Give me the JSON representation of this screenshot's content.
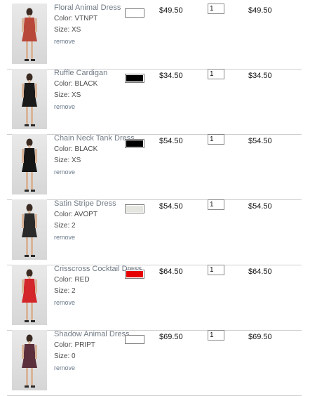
{
  "remove_label": "remove",
  "color_prefix": "Color: ",
  "size_prefix": "Size: ",
  "items": [
    {
      "name": "Floral Animal Dress",
      "color": "VTNPT",
      "size": "XS",
      "price": "$49.50",
      "qty": "1",
      "total": "$49.50",
      "swatch": "#ffffff",
      "dress": "#b8483a"
    },
    {
      "name": "Ruffle Cardigan",
      "color": "BLACK",
      "size": "XS",
      "price": "$34.50",
      "qty": "1",
      "total": "$34.50",
      "swatch": "#000000",
      "dress": "#1a1a1a"
    },
    {
      "name": "Chain Neck Tank Dress",
      "color": "BLACK",
      "size": "XS",
      "price": "$54.50",
      "qty": "1",
      "total": "$54.50",
      "swatch": "#000000",
      "dress": "#151515"
    },
    {
      "name": "Satin Stripe Dress",
      "color": "AVOPT",
      "size": "2",
      "price": "$54.50",
      "qty": "1",
      "total": "$54.50",
      "swatch": "#e6e6e0",
      "dress": "#2a2a2a"
    },
    {
      "name": "Crisscross Cocktail Dress",
      "color": "RED",
      "size": "2",
      "price": "$64.50",
      "qty": "1",
      "total": "$64.50",
      "swatch": "#e60000",
      "dress": "#d2262a"
    },
    {
      "name": "Shadow Animal Dress",
      "color": "PRIPT",
      "size": "0",
      "price": "$69.50",
      "qty": "1",
      "total": "$69.50",
      "swatch": "#ffffff",
      "dress": "#5b2f3c"
    }
  ]
}
